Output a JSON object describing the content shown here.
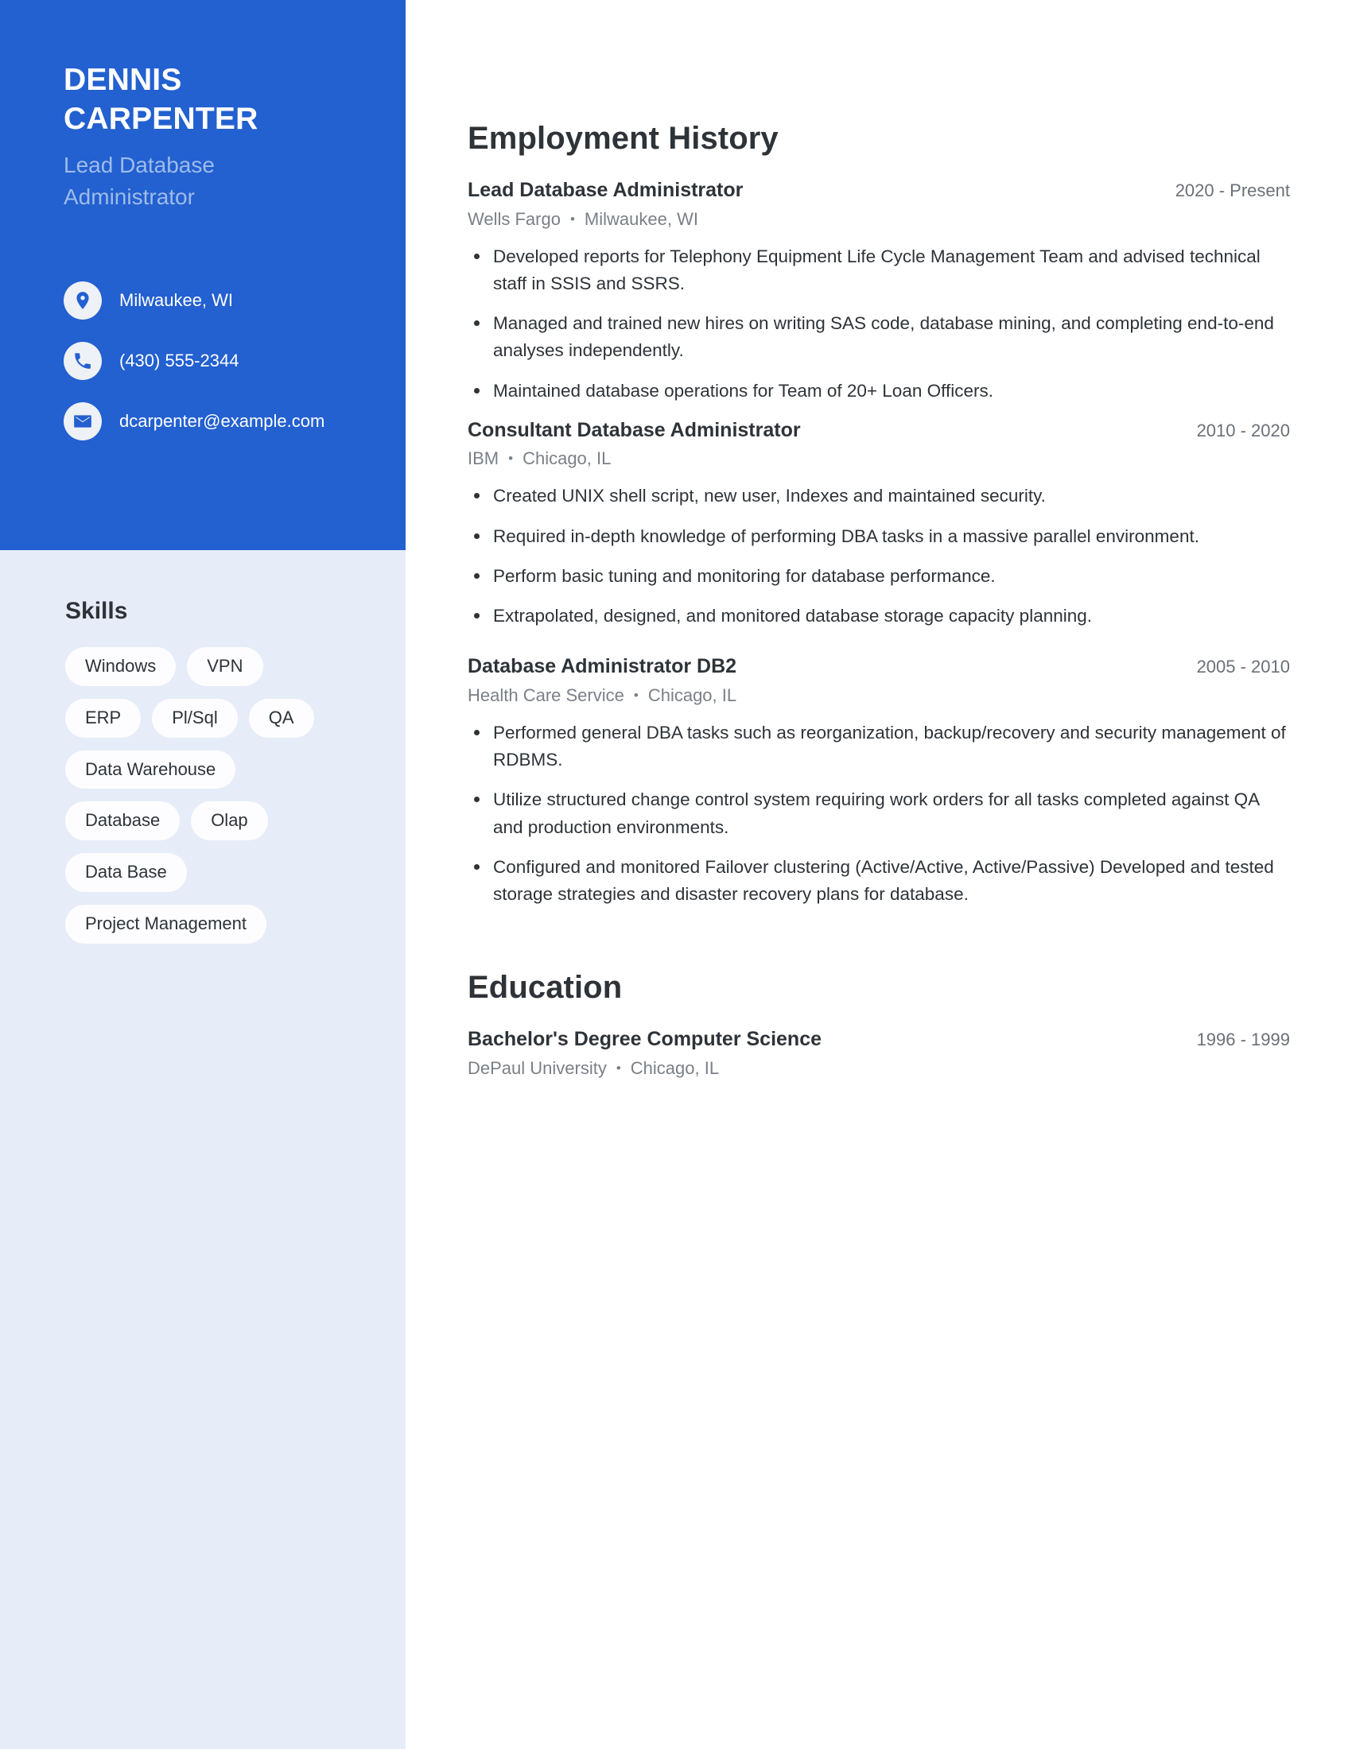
{
  "sidebar": {
    "name_lines": [
      "DENNIS",
      "CARPENTER"
    ],
    "role_lines": [
      "Lead Database",
      "Administrator"
    ],
    "contacts": [
      {
        "icon": "location-pin-icon",
        "text": "Milwaukee, WI"
      },
      {
        "icon": "phone-icon",
        "text": "(430) 555-2344"
      },
      {
        "icon": "email-envelope-icon",
        "text": "dcarpenter@example.com"
      }
    ],
    "skills_title": "Skills",
    "skill_rows": [
      [
        "Windows",
        "VPN"
      ],
      [
        "ERP",
        "Pl/Sql",
        "QA"
      ],
      [
        "Data Warehouse"
      ],
      [
        "Database",
        "Olap"
      ],
      [
        "Data Base"
      ],
      [
        "Project Management"
      ]
    ]
  },
  "main": {
    "employment_title": "Employment History",
    "jobs": [
      {
        "title": "Lead Database Administrator",
        "dates": "2020 - Present",
        "company": "Wells Fargo",
        "location": "Milwaukee, WI",
        "bullets": [
          "Developed reports for Telephony Equipment Life Cycle Management Team and advised technical staff in SSIS and SSRS.",
          "Managed and trained new hires on writing SAS code, database mining, and completing end-to-end analyses independently.",
          "Maintained database operations for Team of 20+ Loan Officers."
        ]
      },
      {
        "title": "Consultant Database Administrator",
        "dates": "2010 - 2020",
        "company": "IBM",
        "location": "Chicago, IL",
        "bullets": [
          "Created UNIX shell script, new user, Indexes and maintained security.",
          "Required in-depth knowledge of performing DBA tasks in a massive parallel environment.",
          "Perform basic tuning and monitoring for database performance.",
          "Extrapolated, designed, and monitored database storage capacity planning."
        ]
      },
      {
        "title": "Database Administrator DB2",
        "dates": "2005 - 2010",
        "company": "Health Care Service",
        "location": "Chicago, IL",
        "bullets": [
          "Performed general DBA tasks such as reorganization, backup/recovery and security management of RDBMS.",
          "Utilize structured change control system requiring work orders for all tasks completed against QA and production environments.",
          "Configured and monitored Failover clustering (Active/Active, Active/Passive) Developed and tested storage strategies and disaster recovery plans for database."
        ]
      }
    ],
    "education_title": "Education",
    "education": [
      {
        "degree": "Bachelor's Degree Computer Science",
        "dates": "1996 - 1999",
        "school": "DePaul University",
        "location": "Chicago, IL"
      }
    ],
    "separator": "•"
  },
  "colors": {
    "header_blue": "#2360d0",
    "sidebar_blue": "#e6ecf8",
    "role_text": "#9dbcea",
    "body_text": "#2e3338",
    "muted_text": "#7b8087",
    "pill_bg": "#fdfdff"
  }
}
